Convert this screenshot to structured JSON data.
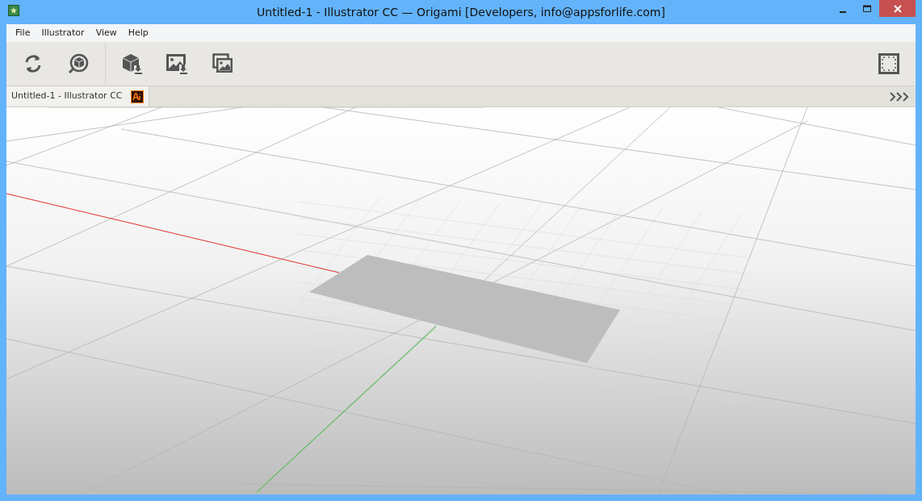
{
  "window": {
    "title": "Untitled-1 - Illustrator CC — Origami [Developers, info@appsforlife.com]"
  },
  "menu": [
    "File",
    "Illustrator",
    "View",
    "Help"
  ],
  "toolbar": {
    "groups": [
      [
        {
          "kind": "refresh"
        },
        {
          "kind": "view3d"
        }
      ],
      [
        {
          "kind": "export-model"
        },
        {
          "kind": "export-image"
        },
        {
          "kind": "images"
        }
      ]
    ],
    "right": [
      {
        "kind": "frame"
      }
    ]
  },
  "tabs": [
    {
      "label": "Untitled-1 - Illustrator CC",
      "selected": true
    }
  ]
}
